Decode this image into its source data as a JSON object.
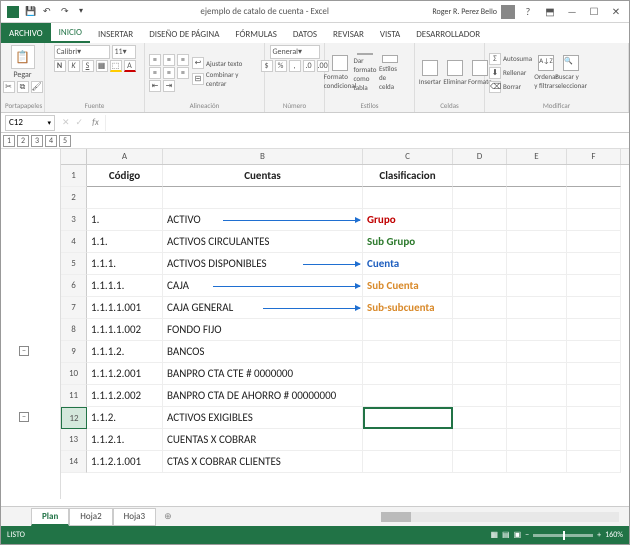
{
  "title": "ejemplo de catalo de cuenta - Excel",
  "user": "Roger R. Perez Bello",
  "tabs": [
    "INICIO",
    "INSERTAR",
    "DISEÑO DE PÁGINA",
    "FÓRMULAS",
    "DATOS",
    "REVISAR",
    "VISTA",
    "DESARROLLADOR"
  ],
  "active_tab_index": 0,
  "ribbon": {
    "clipboard": {
      "paste": "Pegar",
      "label": "Portapapeles"
    },
    "font": {
      "name": "Calibri",
      "size": "11",
      "label": "Fuente"
    },
    "align": {
      "wrap": "Ajustar texto",
      "merge": "Combinar y centrar",
      "label": "Alineación"
    },
    "number": {
      "format": "General",
      "label": "Número"
    },
    "styles": {
      "cond": "Formato condicional",
      "table": "Dar formato como tabla",
      "cell": "Estilos de celda",
      "label": "Estilos"
    },
    "cells": {
      "insert": "Insertar",
      "delete": "Eliminar",
      "format": "Formato",
      "label": "Celdas"
    },
    "editing": {
      "sum": "Autosuma",
      "fill": "Rellenar",
      "clear": "Borrar",
      "sort": "Ordenar y filtrar",
      "find": "Buscar y seleccionar",
      "label": "Modificar"
    }
  },
  "namebox": "C12",
  "formula": "",
  "outline_levels": [
    "1",
    "2",
    "3",
    "4",
    "5"
  ],
  "columns": [
    "A",
    "B",
    "C",
    "D",
    "E",
    "F"
  ],
  "header_row": {
    "num": "1",
    "a": "Código",
    "b": "Cuentas",
    "c": "Clasificacion"
  },
  "rows": [
    {
      "num": "2",
      "a": "",
      "b": "",
      "c": "",
      "arrow": false
    },
    {
      "num": "3",
      "a": "1.",
      "b": "ACTIVO",
      "c": "Grupo",
      "cclass": "c-red",
      "arrow": true,
      "astart": 60
    },
    {
      "num": "4",
      "a": "1.1.",
      "b": "ACTIVOS CIRCULANTES",
      "c": "Sub Grupo",
      "cclass": "c-green",
      "arrow": false
    },
    {
      "num": "5",
      "a": "1.1.1.",
      "b": "ACTIVOS DISPONIBLES",
      "c": "Cuenta",
      "cclass": "c-blue",
      "arrow": true,
      "astart": 140
    },
    {
      "num": "6",
      "a": "1.1.1.1.",
      "b": "CAJA",
      "c": "Sub Cuenta",
      "cclass": "c-orange",
      "arrow": true,
      "astart": 50
    },
    {
      "num": "7",
      "a": "1.1.1.1.001",
      "b": "CAJA GENERAL",
      "c": "Sub-subcuenta",
      "cclass": "c-orange",
      "arrow": true,
      "astart": 100
    },
    {
      "num": "8",
      "a": "1.1.1.1.002",
      "b": "FONDO FIJO",
      "c": "",
      "arrow": false
    },
    {
      "num": "9",
      "a": "1.1.1.2.",
      "b": "BANCOS",
      "c": "",
      "arrow": false
    },
    {
      "num": "10",
      "a": "1.1.1.2.001",
      "b": "BANPRO CTA CTE # 0000000",
      "c": "",
      "arrow": false
    },
    {
      "num": "11",
      "a": "1.1.1.2.002",
      "b": "BANPRO CTA DE AHORRO # 00000000",
      "c": "",
      "arrow": false
    },
    {
      "num": "12",
      "a": "1.1.2.",
      "b": "ACTIVOS EXIGIBLES",
      "c": "",
      "arrow": false,
      "selected": true
    },
    {
      "num": "13",
      "a": "1.1.2.1.",
      "b": "CUENTAS X COBRAR",
      "c": "",
      "arrow": false
    },
    {
      "num": "14",
      "a": "1.1.2.1.001",
      "b": "CTAS X COBRAR CLIENTES",
      "c": "",
      "arrow": false
    }
  ],
  "sheets": [
    "Plan",
    "Hoja2",
    "Hoja3"
  ],
  "active_sheet": 0,
  "status": {
    "mode": "LISTO",
    "zoom": "160%"
  }
}
